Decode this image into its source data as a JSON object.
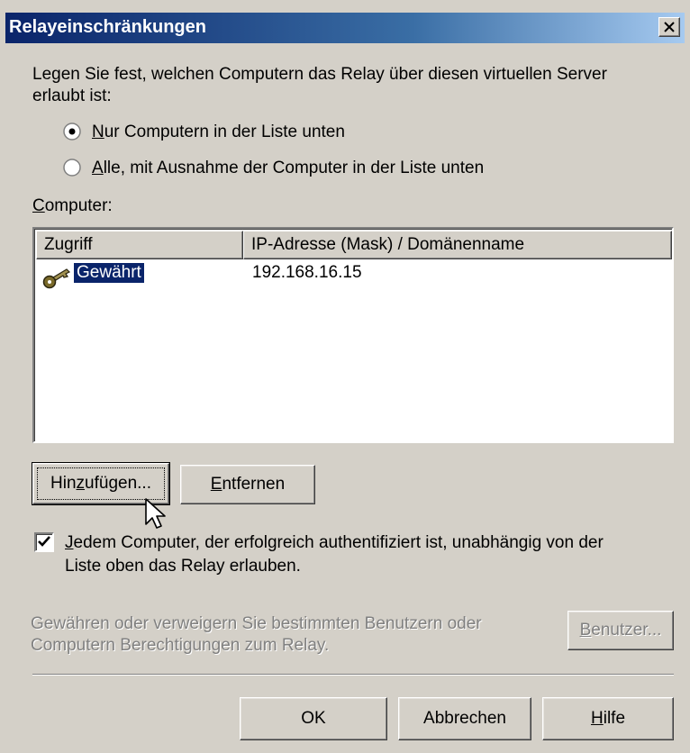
{
  "window": {
    "title": "Relayeinschränkungen"
  },
  "intro": {
    "line1": "Legen Sie fest, welchen Computern das Relay über diesen virtuellen Server",
    "line2": "erlaubt ist:"
  },
  "radios": {
    "only_list": {
      "pre": "",
      "accel": "N",
      "post": "ur Computern in der Liste unten",
      "selected": true
    },
    "all_except": {
      "pre": "",
      "accel": "A",
      "post": "lle, mit Ausnahme der Computer in der Liste unten",
      "selected": false
    }
  },
  "computer_label": {
    "accel": "C",
    "post": "omputer:"
  },
  "list": {
    "columns": [
      "Zugriff",
      "IP-Adresse (Mask) / Domänenname"
    ],
    "rows": [
      {
        "access": "Gewährt",
        "address": "192.168.16.15",
        "icon": "key-icon"
      }
    ]
  },
  "buttons": {
    "add": {
      "pre": "Hin",
      "accel": "z",
      "post": "ufügen..."
    },
    "remove": {
      "pre": "",
      "accel": "E",
      "post": "ntfernen"
    },
    "users": {
      "pre": "",
      "accel": "B",
      "post": "enutzer..."
    },
    "ok": "OK",
    "cancel": "Abbrechen",
    "help": {
      "pre": "",
      "accel": "H",
      "post": "ilfe"
    }
  },
  "auth_checkbox": {
    "checked": true,
    "accel": "J",
    "line1_post": "edem Computer, der erfolgreich authentifiziert ist, unabhängig von der",
    "line2": "Liste oben das Relay erlauben."
  },
  "users_text": {
    "line1": "Gewähren oder verweigern Sie bestimmten Benutzern oder",
    "line2": "Computern Berechtigungen zum Relay."
  }
}
